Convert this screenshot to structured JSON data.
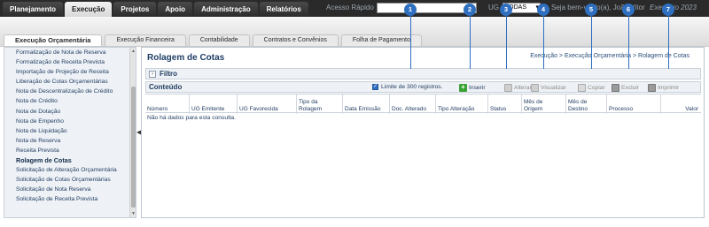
{
  "topmenu": {
    "items": [
      "Planejamento",
      "Execução",
      "Projetos",
      "Apoio",
      "Administração",
      "Relatórios"
    ],
    "acesso_label": "Acesso Rápido",
    "acesso_value": "",
    "ug_label": "UG",
    "ug_selected": "TODAS",
    "welcome": "Seja bem-vindo(a), João Vitor",
    "exercicio": "Exercício 2023"
  },
  "tabs": [
    "Execução Orçamentária",
    "Execução Financeira",
    "Contabilidade",
    "Contratos e Convênios",
    "Folha de Pagamento"
  ],
  "sidebar": {
    "items": [
      "Formalização de Nota de Reserva",
      "Formalização de Receita Prevista",
      "Importação de Projeção de Receita",
      "Liberação de Cotas Orçamentárias",
      "Nota de Descentralização de Crédito",
      "Nota de Crédito",
      "Nota de Dotação",
      "Nota de Empenho",
      "Nota de Liquidação",
      "Nota de Reserva",
      "Receita Prevista",
      "Rolagem de Cotas",
      "Solicitação de Alteração Orçamentária",
      "Solicitação de Cotas Orçamentárias",
      "Solicitação de Nota Reserva",
      "Solicitação de Receita Prevista"
    ],
    "selected": "Rolagem de Cotas"
  },
  "main": {
    "title": "Rolagem de Cotas",
    "breadcrumb": "Execução > Execução Orçamentária > Rolagem de Cotas",
    "filter_label": "Filtro",
    "content_label": "Conteúdo",
    "limit_label": "Limite de 300 registros.",
    "limit_checked": true,
    "toolbar": {
      "inserir": "Inserir",
      "alterar": "Alterar",
      "visualizar": "Visualizar",
      "copiar": "Copiar",
      "excluir": "Excluir",
      "imprimir": "Imprimir"
    },
    "columns": [
      "Número",
      "UG Emitente",
      "UG Favorecida",
      "Tipo da Rolagem",
      "Data Emissão",
      "Doc. Alterado",
      "Tipo Alteração",
      "Status",
      "Mês de Origem",
      "Mês de Destino",
      "Processo",
      "Valor"
    ],
    "empty_message": "Não há dados para esta consulta."
  },
  "callouts": [
    "1",
    "2",
    "3",
    "4",
    "5",
    "6",
    "7"
  ],
  "colors": {
    "callout": "#2f6fc0",
    "topbar": "#2a2a2a",
    "inserir_icon": "#3aa335"
  }
}
